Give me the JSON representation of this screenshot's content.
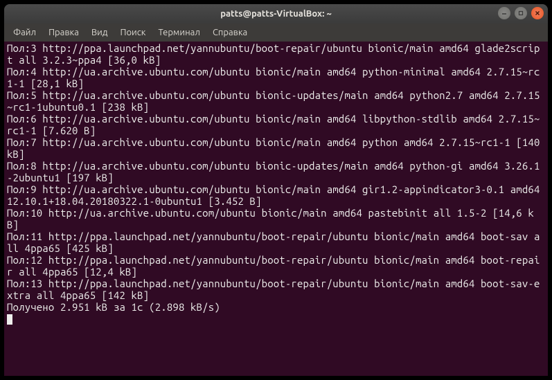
{
  "window": {
    "title": "patts@patts-VirtualBox: ~"
  },
  "menu": {
    "file": "Файл",
    "edit": "Правка",
    "view": "Вид",
    "search": "Поиск",
    "terminal": "Терминал",
    "help": "Справка"
  },
  "terminal": {
    "lines": [
      "Пол:3 http://ppa.launchpad.net/yannubuntu/boot-repair/ubuntu bionic/main amd64 glade2script all 3.2.3~ppa4 [36,0 kB]",
      "Пол:4 http://ua.archive.ubuntu.com/ubuntu bionic/main amd64 python-minimal amd64 2.7.15~rc1-1 [28,1 kB]",
      "Пол:5 http://ua.archive.ubuntu.com/ubuntu bionic-updates/main amd64 python2.7 amd64 2.7.15~rc1-1ubuntu0.1 [238 kB]",
      "Пол:6 http://ua.archive.ubuntu.com/ubuntu bionic/main amd64 libpython-stdlib amd64 2.7.15~rc1-1 [7.620 B]",
      "Пол:7 http://ua.archive.ubuntu.com/ubuntu bionic/main amd64 python amd64 2.7.15~rc1-1 [140 kB]",
      "Пол:8 http://ua.archive.ubuntu.com/ubuntu bionic-updates/main amd64 python-gi amd64 3.26.1-2ubuntu1 [197 kB]",
      "Пол:9 http://ua.archive.ubuntu.com/ubuntu bionic/main amd64 gir1.2-appindicator3-0.1 amd64 12.10.1+18.04.20180322.1-0ubuntu1 [3.452 B]",
      "Пол:10 http://ua.archive.ubuntu.com/ubuntu bionic/main amd64 pastebinit all 1.5-2 [14,6 kB]",
      "Пол:11 http://ppa.launchpad.net/yannubuntu/boot-repair/ubuntu bionic/main amd64 boot-sav all 4ppa65 [425 kB]",
      "Пол:12 http://ppa.launchpad.net/yannubuntu/boot-repair/ubuntu bionic/main amd64 boot-repair all 4ppa65 [12,4 kB]",
      "Пол:13 http://ppa.launchpad.net/yannubuntu/boot-repair/ubuntu bionic/main amd64 boot-sav-extra all 4ppa65 [142 kB]",
      "Получено 2.951 kB за 1с (2.898 kB/s)"
    ]
  }
}
